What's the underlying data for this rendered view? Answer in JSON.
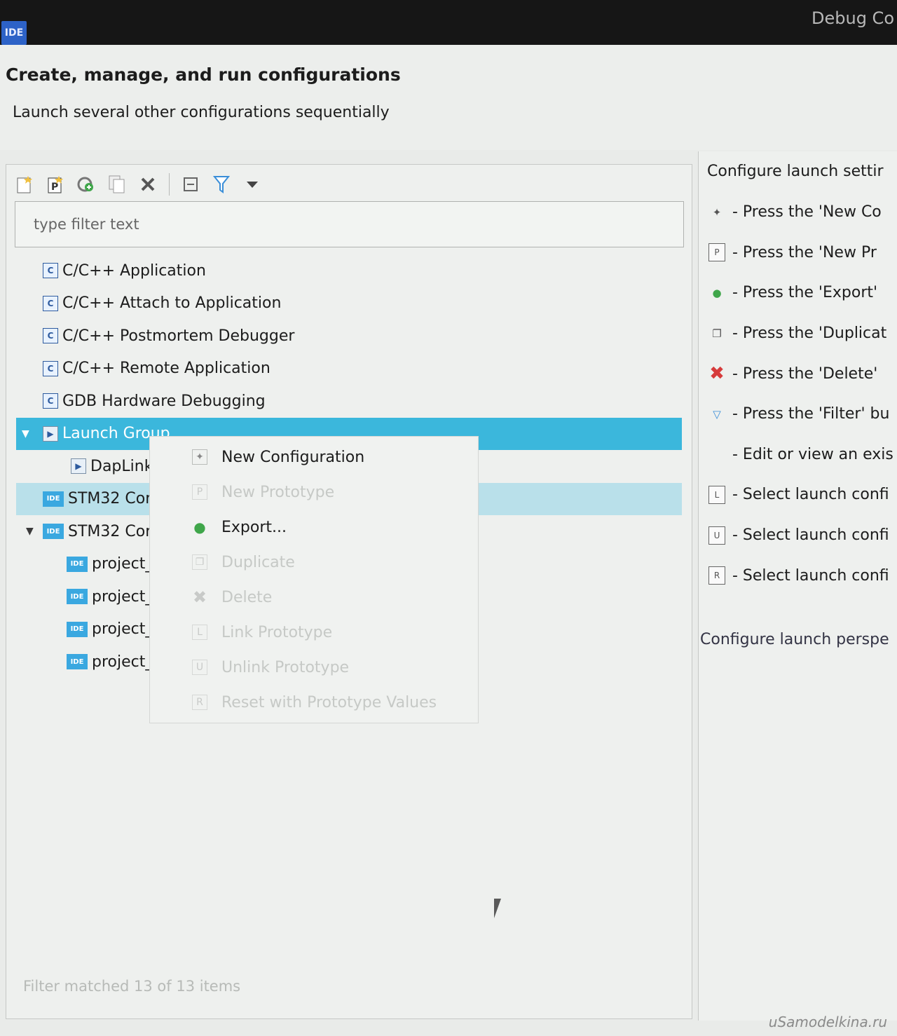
{
  "window": {
    "app_icon": "IDE",
    "title": "Debug Co"
  },
  "header": {
    "title": "Create, manage, and run configurations",
    "subtitle": "Launch several other configurations sequentially"
  },
  "toolbar": {
    "icons": [
      "new-config-icon",
      "new-prototype-icon",
      "export-icon",
      "duplicate-icon",
      "delete-icon",
      "collapse-all-icon",
      "filter-icon",
      "view-menu-icon"
    ]
  },
  "filter": {
    "placeholder": "type filter text"
  },
  "tree": {
    "items": [
      {
        "label": "C/C++ Application",
        "icon": "C"
      },
      {
        "label": "C/C++ Attach to Application",
        "icon": "C"
      },
      {
        "label": "C/C++ Postmortem Debugger",
        "icon": "C"
      },
      {
        "label": "C/C++ Remote Application",
        "icon": "C"
      },
      {
        "label": "GDB Hardware Debugging",
        "icon": "C"
      },
      {
        "label": "Launch Group",
        "icon": "launch-group-icon"
      },
      {
        "label": "DapLink",
        "icon": "launch-config-icon"
      },
      {
        "label": "STM32 Cor",
        "icon": "IDE"
      },
      {
        "label": "STM32 Cor",
        "icon": "IDE"
      },
      {
        "label": "project_",
        "icon": "IDE"
      },
      {
        "label": "project_",
        "icon": "IDE"
      },
      {
        "label": "project_",
        "icon": "IDE"
      },
      {
        "label": "project_",
        "icon": "IDE"
      }
    ]
  },
  "status": "Filter matched 13 of 13 items",
  "context_menu": {
    "items": [
      {
        "label": "New Configuration",
        "icon": "new-config-icon",
        "enabled": true
      },
      {
        "label": "New Prototype",
        "icon": "P",
        "enabled": false
      },
      {
        "label": "Export...",
        "icon": "export-icon",
        "enabled": true
      },
      {
        "label": "Duplicate",
        "icon": "duplicate-icon",
        "enabled": false
      },
      {
        "label": "Delete",
        "icon": "delete-icon",
        "enabled": false
      },
      {
        "label": "Link Prototype",
        "icon": "L",
        "enabled": false
      },
      {
        "label": "Unlink Prototype",
        "icon": "U",
        "enabled": false
      },
      {
        "label": "Reset with Prototype Values",
        "icon": "R",
        "enabled": false
      }
    ]
  },
  "right_pane": {
    "title": "Configure launch settir",
    "rows": [
      {
        "icon": "new-config-icon",
        "text": "- Press the 'New Co"
      },
      {
        "icon": "new-prototype-icon",
        "text": "- Press the 'New Pr"
      },
      {
        "icon": "export-icon",
        "text": "- Press the 'Export'"
      },
      {
        "icon": "duplicate-icon",
        "text": "- Press the 'Duplicat"
      },
      {
        "icon": "delete-icon",
        "text": "- Press the 'Delete'"
      },
      {
        "icon": "filter-icon",
        "text": "- Press the 'Filter' bu"
      },
      {
        "icon": "",
        "text": "- Edit or view an exis"
      },
      {
        "icon": "L",
        "text": "- Select launch confi"
      },
      {
        "icon": "U",
        "text": "- Select launch confi"
      },
      {
        "icon": "R",
        "text": "- Select launch confi"
      }
    ],
    "footer": "Configure launch perspe"
  },
  "watermark": "uSamodelkina.ru"
}
